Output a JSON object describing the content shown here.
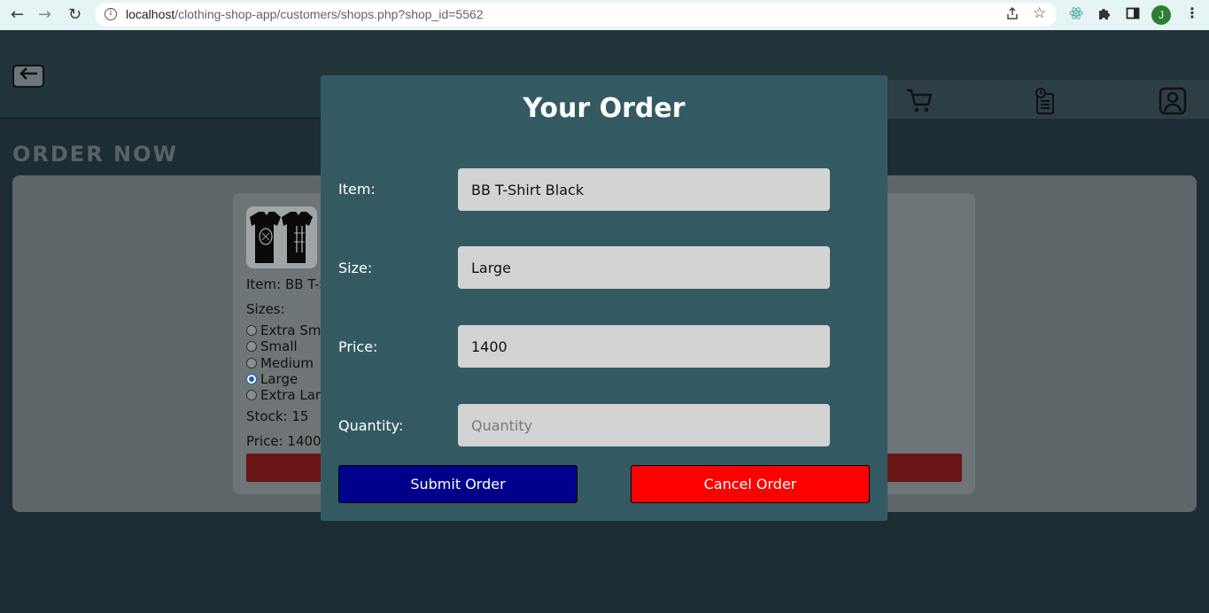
{
  "browser": {
    "url_host": "localhost",
    "url_path": "/clothing-shop-app/customers/shops.php?shop_id=5562",
    "profile_initial": "J",
    "back_glyph": "←",
    "forward_glyph": "→",
    "reload_glyph": "↻"
  },
  "page": {
    "heading": "ORDER NOW",
    "nav_icons": [
      "cart-icon",
      "order-history-icon",
      "profile-icon"
    ]
  },
  "product": {
    "item_label": "Item: BB T-S",
    "sizes_label": "Sizes:",
    "sizes": [
      {
        "label": "Extra Sma",
        "checked": false
      },
      {
        "label": "Small",
        "checked": false
      },
      {
        "label": "Medium",
        "checked": false
      },
      {
        "label": "Large",
        "checked": true
      },
      {
        "label": "Extra Larg",
        "checked": false
      }
    ],
    "stock_label": "Stock: 15",
    "price_label": "Price: 1400"
  },
  "modal": {
    "title": "Your Order",
    "fields": [
      {
        "label": "Item:",
        "value": "BB T-Shirt Black",
        "placeholder": ""
      },
      {
        "label": "Size:",
        "value": "Large",
        "placeholder": ""
      },
      {
        "label": "Price:",
        "value": "1400",
        "placeholder": ""
      },
      {
        "label": "Quantity:",
        "value": "",
        "placeholder": "Quantity"
      }
    ],
    "submit_label": "Submit Order",
    "cancel_label": "Cancel Order"
  },
  "colors": {
    "modal_bg": "#335a63",
    "submit_bg": "#00008b",
    "cancel_bg": "#ff0000"
  }
}
